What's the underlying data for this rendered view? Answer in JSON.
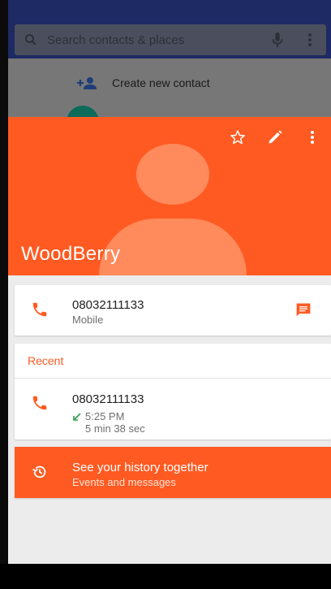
{
  "search": {
    "placeholder": "Search contacts & places"
  },
  "background_list": {
    "create_label": "Create new contact"
  },
  "contact": {
    "name": "WoodBerry"
  },
  "phone_card": {
    "number": "08032111133",
    "type": "Mobile"
  },
  "recent": {
    "title": "Recent",
    "number": "08032111133",
    "time": "5:25 PM",
    "duration": "5 min 38 sec"
  },
  "history": {
    "title": "See your history together",
    "subtitle": "Events and messages"
  },
  "colors": {
    "accent": "#ff5a22",
    "status_bar": "#1e2a63",
    "call_icon": "#ff5a22",
    "incoming_arrow": "#2e9d4f"
  },
  "icons": [
    "search-icon",
    "mic-icon",
    "more-vert-icon",
    "person-add-icon",
    "star-outline-icon",
    "edit-icon",
    "phone-icon",
    "message-icon",
    "history-icon"
  ]
}
